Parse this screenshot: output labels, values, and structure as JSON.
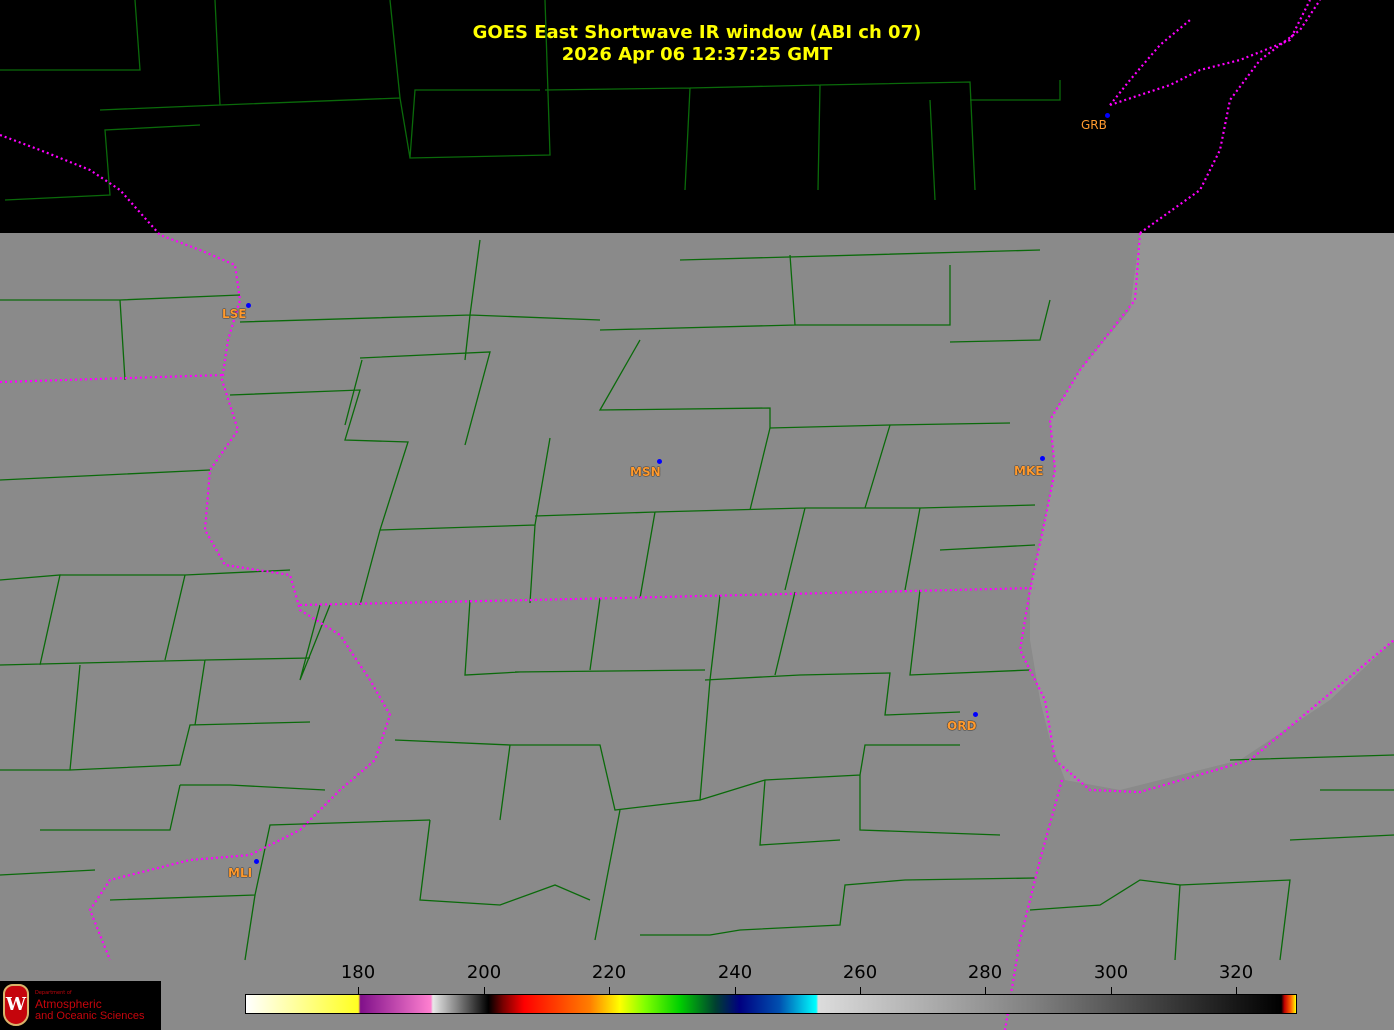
{
  "title": {
    "line1": "GOES East Shortwave IR window (ABI ch 07)",
    "line2": "2026 Apr 06  12:37:25 GMT"
  },
  "stations": [
    {
      "id": "GRB"
    },
    {
      "id": "LSE"
    },
    {
      "id": "MSN"
    },
    {
      "id": "MKE"
    },
    {
      "id": "ORD"
    },
    {
      "id": "MLI"
    }
  ],
  "colorbar": {
    "unit_range": [
      162,
      329
    ],
    "ticks": [
      "180",
      "200",
      "220",
      "240",
      "260",
      "280",
      "300",
      "320"
    ]
  },
  "logo": {
    "line1": "Department of",
    "line2": "Atmospheric",
    "line3": "and Oceanic Sciences"
  },
  "colors": {
    "county": "#006400",
    "state": "#ff00ff",
    "title": "#ffff00",
    "station": "#ff9a2e"
  }
}
